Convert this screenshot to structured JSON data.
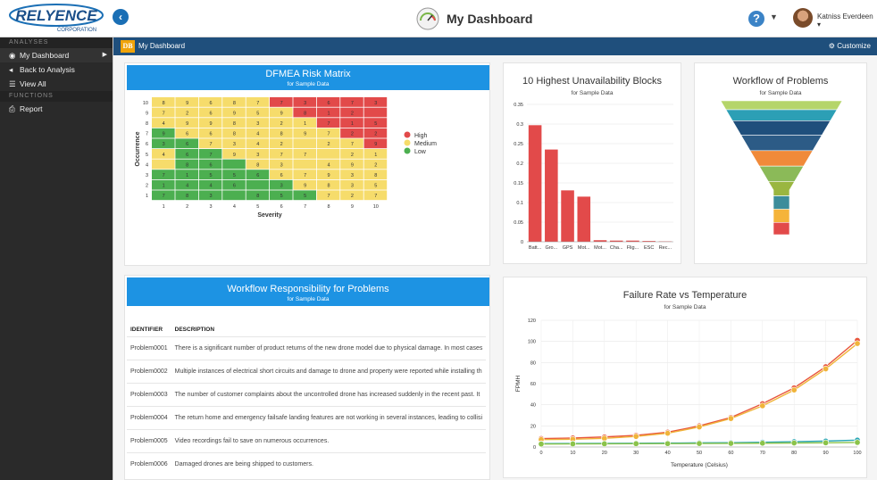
{
  "header": {
    "logo_text": "RELYENCE",
    "logo_sub": "CORPORATION",
    "title": "My Dashboard",
    "user": "Katniss Everdeen"
  },
  "sidebar": {
    "analyses_header": "ANALYSES",
    "items": [
      {
        "label": "My Dashboard"
      },
      {
        "label": "Back to Analysis"
      },
      {
        "label": "View All"
      }
    ],
    "functions_header": "FUNCTIONS",
    "report": "Report"
  },
  "dashboard": {
    "badge": "DB",
    "title": "My Dashboard",
    "customize": "Customize"
  },
  "risk_matrix": {
    "title": "DFMEA Risk Matrix",
    "subtitle": "for Sample Data",
    "xlabel": "Severity",
    "ylabel": "Occurrence",
    "x_ticks": [
      "1",
      "2",
      "3",
      "4",
      "5",
      "6",
      "7",
      "8",
      "9",
      "10"
    ],
    "y_ticks": [
      "10",
      "9",
      "8",
      "7",
      "6",
      "5",
      "4",
      "3",
      "2",
      "1"
    ],
    "legend": [
      {
        "label": "High",
        "color": "#e24a4a"
      },
      {
        "label": "Medium",
        "color": "#f6dc6b"
      },
      {
        "label": "Low",
        "color": "#4caf50"
      }
    ],
    "rows": [
      [
        "8y",
        "9y",
        "6y",
        "8y",
        "7y",
        "7r",
        "3r",
        "6r",
        "7r",
        "3r"
      ],
      [
        "7y",
        "2y",
        "6y",
        "9y",
        "5y",
        "9y",
        "8r",
        "1r",
        "2r",
        "r"
      ],
      [
        "4y",
        "9y",
        "9y",
        "8y",
        "3y",
        "2y",
        "1y",
        "7r",
        "1r",
        "5r"
      ],
      [
        "9g",
        "6y",
        "6y",
        "8y",
        "4y",
        "8y",
        "9y",
        "7y",
        "2r",
        "2r"
      ],
      [
        "3g",
        "6g",
        "7y",
        "3y",
        "4y",
        "2y",
        "y",
        "2y",
        "7y",
        "9r"
      ],
      [
        "4y",
        "6g",
        "7g",
        "9y",
        "3y",
        "7y",
        "7y",
        "y",
        "2y",
        "1y"
      ],
      [
        "y",
        "8g",
        "6g",
        "g",
        "8y",
        "3y",
        "y",
        "4y",
        "9y",
        "2y"
      ],
      [
        "7g",
        "1g",
        "5g",
        "5g",
        "6g",
        "6y",
        "7y",
        "9y",
        "3y",
        "8y"
      ],
      [
        "1g",
        "4g",
        "4g",
        "6g",
        "g",
        "3g",
        "9y",
        "8y",
        "3y",
        "5y"
      ],
      [
        "7g",
        "8g",
        "3g",
        "g",
        "8g",
        "5g",
        "5g",
        "7y",
        "2y",
        "7y"
      ]
    ]
  },
  "unavailability": {
    "title": "10 Highest Unavailability Blocks",
    "subtitle": "for Sample Data"
  },
  "chart_data": [
    {
      "type": "bar",
      "title": "10 Highest Unavailability Blocks",
      "subtitle": "for Sample Data",
      "categories": [
        "Batt...",
        "Gro...",
        "GPS",
        "Mot...",
        "Mot...",
        "Cha...",
        "Flig...",
        "ESC",
        "Rec..."
      ],
      "values": [
        0.297,
        0.235,
        0.131,
        0.115,
        0.004,
        0.003,
        0.003,
        0.002,
        0.001
      ],
      "ylim": [
        0,
        0.35
      ],
      "yticks": [
        "0",
        "0.05",
        "0.1",
        "0.15",
        "0.2",
        "0.25",
        "0.3",
        "0.35"
      ],
      "color": "#e24a4a"
    },
    {
      "type": "line",
      "title": "Failure Rate vs Temperature",
      "subtitle": "for Sample Data",
      "xlabel": "Temperature (Celsius)",
      "ylabel": "FPMH",
      "x": [
        0,
        10,
        20,
        30,
        40,
        50,
        60,
        70,
        80,
        90,
        100
      ],
      "xlim": [
        0,
        100
      ],
      "ylim": [
        0,
        120
      ],
      "xticks": [
        "0",
        "10",
        "20",
        "30",
        "40",
        "50",
        "60",
        "70",
        "80",
        "90",
        "100"
      ],
      "yticks": [
        "0",
        "20",
        "40",
        "60",
        "80",
        "100",
        "120"
      ],
      "series": [
        {
          "color": "#e8563c",
          "values": [
            8,
            8.5,
            9.5,
            11,
            14,
            20,
            28,
            41,
            56,
            76,
            101
          ]
        },
        {
          "color": "#f0b43a",
          "values": [
            7,
            7.3,
            8.2,
            10,
            13,
            19,
            27,
            39,
            54,
            74,
            98
          ]
        },
        {
          "color": "#2aa7b5",
          "values": [
            3.2,
            3.3,
            3.4,
            3.5,
            3.7,
            3.9,
            4.1,
            4.5,
            5,
            5.6,
            6.5
          ]
        },
        {
          "color": "#8bc34a",
          "values": [
            2.8,
            2.9,
            3,
            3.1,
            3.2,
            3.3,
            3.4,
            3.6,
            3.8,
            4,
            4.3
          ]
        }
      ]
    },
    {
      "type": "funnel",
      "title": "Workflow of Problems",
      "subtitle": "for Sample Data",
      "values": [
        8,
        10,
        13,
        14,
        14,
        14,
        13,
        12,
        12,
        11
      ],
      "colors": [
        "#b5d56a",
        "#2c9fb5",
        "#1f4f7c",
        "#2c5b86",
        "#f08a3a",
        "#8bba58",
        "#9ab640",
        "#3c8d9b",
        "#f5b43a",
        "#e24a4a"
      ]
    }
  ],
  "workflow": {
    "title": "Workflow of Problems",
    "subtitle": "for Sample Data"
  },
  "responsibility": {
    "title": "Workflow Responsibility for Problems",
    "subtitle": "for Sample Data",
    "columns": [
      "IDENTIFIER",
      "DESCRIPTION"
    ],
    "rows": [
      {
        "id": "Problem0001",
        "desc": "There is a significant number of product returns of the new drone model due to physical damage. In most cases"
      },
      {
        "id": "Problem0002",
        "desc": "Multiple instances of electrical short circuits and damage to drone and property were reported while installing th"
      },
      {
        "id": "Problem0003",
        "desc": "The number of customer complaints about the uncontrolled drone has increased suddenly in the recent past. It"
      },
      {
        "id": "Problem0004",
        "desc": "The return home and emergency failsafe landing features are not working in several instances, leading to collisi"
      },
      {
        "id": "Problem0005",
        "desc": "Video recordings fail to save on numerous occurrences."
      },
      {
        "id": "Problem0006",
        "desc": "Damaged drones are being shipped to customers."
      }
    ]
  },
  "failure": {
    "title": "Failure Rate vs Temperature",
    "subtitle": "for Sample Data",
    "xlabel": "Temperature (Celsius)",
    "ylabel": "FPMH"
  }
}
